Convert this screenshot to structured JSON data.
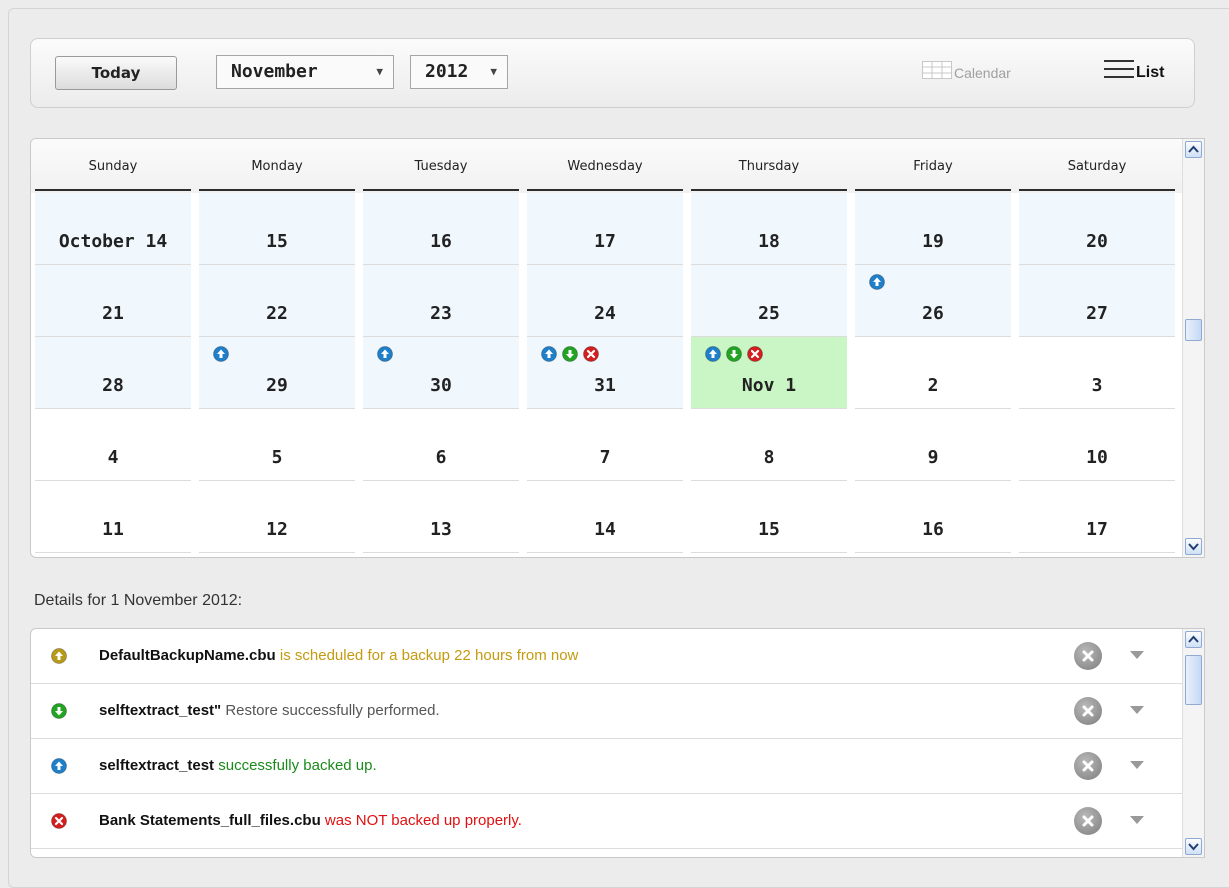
{
  "toolbar": {
    "today_label": "Today",
    "month_value": "November",
    "year_value": "2012",
    "view_calendar_label": "Calendar",
    "view_list_label": "List"
  },
  "calendar": {
    "weekdays": [
      "Sunday",
      "Monday",
      "Tuesday",
      "Wednesday",
      "Thursday",
      "Friday",
      "Saturday"
    ],
    "weeks": [
      [
        {
          "label": "October 14",
          "past": true,
          "icons": []
        },
        {
          "label": "15",
          "past": true,
          "icons": []
        },
        {
          "label": "16",
          "past": true,
          "icons": []
        },
        {
          "label": "17",
          "past": true,
          "icons": []
        },
        {
          "label": "18",
          "past": true,
          "icons": []
        },
        {
          "label": "19",
          "past": true,
          "icons": []
        },
        {
          "label": "20",
          "past": true,
          "icons": []
        }
      ],
      [
        {
          "label": "21",
          "past": true,
          "icons": []
        },
        {
          "label": "22",
          "past": true,
          "icons": []
        },
        {
          "label": "23",
          "past": true,
          "icons": []
        },
        {
          "label": "24",
          "past": true,
          "icons": []
        },
        {
          "label": "25",
          "past": true,
          "icons": []
        },
        {
          "label": "26",
          "past": true,
          "icons": [
            "backup-icon"
          ]
        },
        {
          "label": "27",
          "past": true,
          "icons": []
        }
      ],
      [
        {
          "label": "28",
          "past": true,
          "icons": []
        },
        {
          "label": "29",
          "past": true,
          "icons": [
            "backup-icon"
          ]
        },
        {
          "label": "30",
          "past": true,
          "icons": [
            "backup-icon"
          ]
        },
        {
          "label": "31",
          "past": true,
          "icons": [
            "backup-icon",
            "restore-icon",
            "error-icon"
          ]
        },
        {
          "label": "Nov 1",
          "today": true,
          "icons": [
            "backup-icon",
            "restore-icon",
            "error-icon"
          ]
        },
        {
          "label": "2",
          "icons": []
        },
        {
          "label": "3",
          "icons": []
        }
      ],
      [
        {
          "label": "4",
          "icons": []
        },
        {
          "label": "5",
          "icons": []
        },
        {
          "label": "6",
          "icons": []
        },
        {
          "label": "7",
          "icons": []
        },
        {
          "label": "8",
          "icons": []
        },
        {
          "label": "9",
          "icons": []
        },
        {
          "label": "10",
          "icons": []
        }
      ],
      [
        {
          "label": "11",
          "icons": []
        },
        {
          "label": "12",
          "icons": []
        },
        {
          "label": "13",
          "icons": []
        },
        {
          "label": "14",
          "icons": []
        },
        {
          "label": "15",
          "icons": []
        },
        {
          "label": "16",
          "icons": []
        },
        {
          "label": "17",
          "icons": []
        }
      ]
    ]
  },
  "details": {
    "title": "Details for 1 November 2012:",
    "items": [
      {
        "icon": "scheduled-icon",
        "name": "DefaultBackupName.cbu",
        "message": " is scheduled for a backup 22 hours from now",
        "color": "#c49a10"
      },
      {
        "icon": "restore-icon",
        "name": "selftextract_test\"",
        "message": " Restore successfully performed.",
        "color": "#555555"
      },
      {
        "icon": "backup-icon",
        "name": "selftextract_test",
        "message": " successfully backed up.",
        "color": "#1a8a1a"
      },
      {
        "icon": "error-icon",
        "name": "Bank Statements_full_files.cbu",
        "message": " was NOT backed up properly.",
        "color": "#e01010"
      }
    ]
  },
  "colors": {
    "today_cell": "#c9f6c4",
    "past_cell": "#f0f8fe",
    "backup_icon": "#1f7fc9",
    "restore_icon": "#23a323",
    "error_icon": "#d31f1f",
    "scheduled_icon": "#b89a1a"
  }
}
